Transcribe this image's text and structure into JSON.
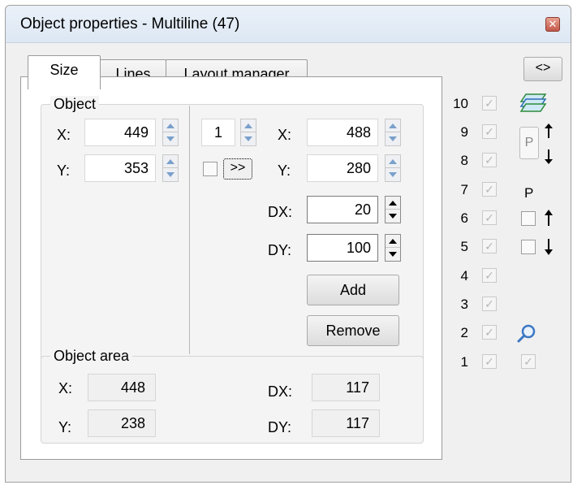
{
  "window": {
    "title": "Object properties - Multiline (47)"
  },
  "tabs": [
    {
      "label": "Size"
    },
    {
      "label": "Lines"
    },
    {
      "label": "Layout manager"
    }
  ],
  "object_group": {
    "label": "Object",
    "x_label": "X:",
    "x_value": "449",
    "y_label": "Y:",
    "y_value": "353"
  },
  "point_editor": {
    "index_value": "1",
    "copy_button": ">>",
    "x_label": "X:",
    "x_value": "488",
    "y_label": "Y:",
    "y_value": "280",
    "dx_label": "DX:",
    "dx_value": "20",
    "dy_label": "DY:",
    "dy_value": "100",
    "add_button": "Add",
    "remove_button": "Remove"
  },
  "area_group": {
    "label": "Object area",
    "x_label": "X:",
    "x_value": "448",
    "y_label": "Y:",
    "y_value": "238",
    "dx_label": "DX:",
    "dx_value": "117",
    "dy_label": "DY:",
    "dy_value": "117"
  },
  "side": {
    "toggle_button": "<>",
    "layer_numbers": [
      "10",
      "9",
      "8",
      "7",
      "6",
      "5",
      "4",
      "3",
      "2",
      "1"
    ],
    "p_up_down_label": "P",
    "p_label": "P",
    "icons": [
      "layers-icon",
      "p-up-down-icon",
      "arrow-up-icon",
      "arrow-down-icon",
      "zoom-icon"
    ]
  },
  "colors": {
    "close_button": "#c3584a",
    "spin_arrow": "#7aa0cc",
    "zoom_icon": "#3b77c4",
    "layers_icon": "#2d8a3a"
  }
}
